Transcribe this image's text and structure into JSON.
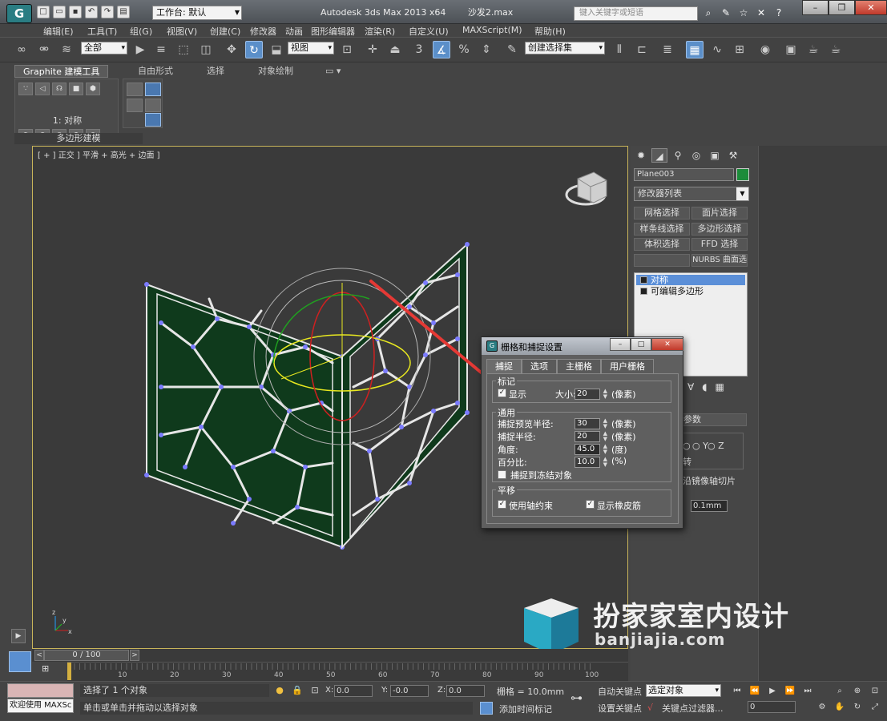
{
  "titlebar": {
    "app_logo": "G",
    "workspace_label": "工作台: 默认",
    "app_name": "Autodesk 3ds Max  2013 x64",
    "document": "沙发2.max",
    "search_placeholder": "键入关键字或短语",
    "qat_icons": [
      "new-file-icon",
      "open-file-icon",
      "save-icon",
      "undo-icon",
      "redo-icon",
      "project-folder-icon"
    ],
    "tool_icons": [
      "binoculars-icon",
      "wrench-icon",
      "star-icon",
      "close-icon",
      "help-icon"
    ]
  },
  "menubar": {
    "items": [
      "编辑(E)",
      "工具(T)",
      "组(G)",
      "视图(V)",
      "创建(C)",
      "修改器",
      "动画",
      "图形编辑器",
      "渲染(R)",
      "自定义(U)",
      "MAXScript(M)",
      "帮助(H)"
    ]
  },
  "toolbar": {
    "selection_filter": "全部",
    "ref_coord": "视图",
    "named_selection": "创建选择集",
    "snap_label": "3"
  },
  "ribbon": {
    "tabs": [
      "Graphite 建模工具",
      "自由形式",
      "选择",
      "对象绘制"
    ],
    "panel_label": "1: 对称",
    "panel_footer": "多边形建模"
  },
  "viewport": {
    "label": "[ + ] 正交 ] 平滑 + 高光 + 边面 ]",
    "wire_color": "#0f3a1c",
    "frame_color": "#c8b45a",
    "axis_labels": [
      "x",
      "y",
      "z"
    ]
  },
  "command_panel": {
    "object_name": "Plane003",
    "object_color": "#1c8c3a",
    "modifier_list": "修改器列表",
    "mod_buttons": [
      "网格选择",
      "面片选择",
      "样条线选择",
      "多边形选择",
      "体积选择",
      "FFD 选择",
      "NURBS 曲面选择"
    ],
    "stack": [
      {
        "label": "对称",
        "selected": true
      },
      {
        "label": "可编辑多边形",
        "selected": false
      }
    ],
    "params_head": "参数",
    "axis_y": "Y",
    "axis_z": "Z",
    "flip_partial": "转",
    "slice_partial": "沿镜像轴切片",
    "threshold": "0.1mm"
  },
  "dialog": {
    "title": "栅格和捕捉设置",
    "tabs": [
      "捕捉",
      "选项",
      "主栅格",
      "用户栅格"
    ],
    "group_mark": "标记",
    "show": "显示",
    "size_label": "大小:",
    "size_value": "20",
    "px_unit": "(像素)",
    "group_general": "通用",
    "preview_radius_label": "捕捉预览半径:",
    "preview_radius_value": "30",
    "snap_radius_label": "捕捉半径:",
    "snap_radius_value": "20",
    "angle_label": "角度:",
    "angle_value": "45.0",
    "angle_unit": "(度)",
    "percent_label": "百分比:",
    "percent_value": "10.0",
    "percent_unit": "(%)",
    "frozen_label": "捕捉到冻结对象",
    "group_translate": "平移",
    "axis_constraint": "使用轴约束",
    "rubber_band": "显示橡皮筋",
    "show_checked": true,
    "axis_checked": true,
    "rubber_checked": true
  },
  "timeline": {
    "slider": "0 / 100",
    "ticks": [
      "10",
      "20",
      "30",
      "40",
      "50",
      "60",
      "70",
      "80",
      "90",
      "100"
    ]
  },
  "status": {
    "maxscript": "欢迎使用 MAXSc",
    "selected_count": "选择了 1 个对象",
    "prompt": "单击或单击并拖动以选择对象",
    "x_label": "X:",
    "x": "0.0",
    "y_label": "Y:",
    "y": "-0.0",
    "z_label": "Z:",
    "z": "0.0",
    "grid": "栅格 = 10.0mm",
    "add_time_tag": "添加时间标记",
    "auto_key": "自动关键点",
    "set_key": "设置关键点",
    "selected_object": "选定对象",
    "key_filters": "关键点过滤器...",
    "frame": "0"
  },
  "watermark": {
    "cn": "扮家家室内设计",
    "en": "banjiajia.com"
  },
  "colors": {
    "accent_blue": "#5b8fc9",
    "arrow_red": "#e53935"
  }
}
